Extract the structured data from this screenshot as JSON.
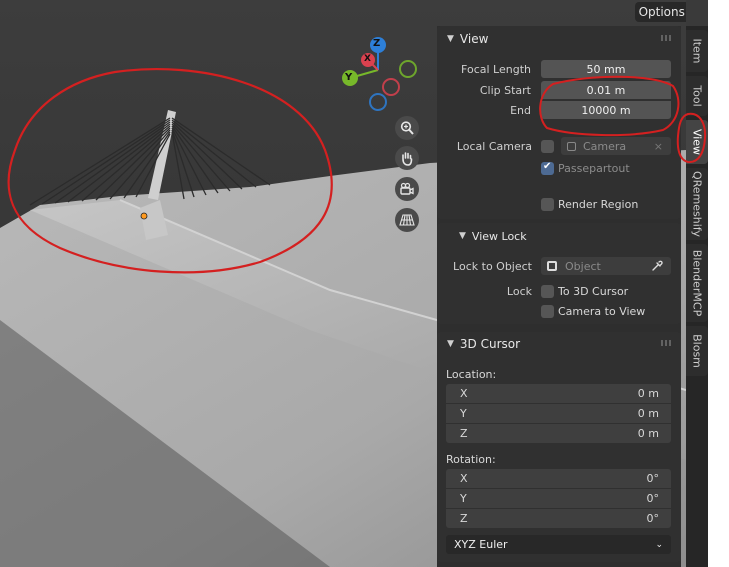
{
  "header": {
    "options_label": "Options"
  },
  "gizmo": {
    "z_label": "Z",
    "y_label": "Y",
    "x_label": "X"
  },
  "panels": {
    "view": {
      "title": "View",
      "focal_length_label": "Focal Length",
      "focal_length_value": "50 mm",
      "clip_start_label": "Clip Start",
      "clip_start_value": "0.01 m",
      "end_label": "End",
      "end_value": "10000 m",
      "local_camera_label": "Local Camera",
      "camera_placeholder": "Camera",
      "passepartout_label": "Passepartout",
      "render_region_label": "Render Region"
    },
    "view_lock": {
      "title": "View Lock",
      "lock_to_object_label": "Lock to Object",
      "object_placeholder": "Object",
      "lock_label": "Lock",
      "to_3d_cursor_label": "To 3D Cursor",
      "camera_to_view_label": "Camera to View"
    },
    "cursor": {
      "title": "3D Cursor",
      "location_label": "Location:",
      "location": [
        {
          "axis": "X",
          "value": "0 m"
        },
        {
          "axis": "Y",
          "value": "0 m"
        },
        {
          "axis": "Z",
          "value": "0 m"
        }
      ],
      "rotation_label": "Rotation:",
      "rotation": [
        {
          "axis": "X",
          "value": "0°"
        },
        {
          "axis": "Y",
          "value": "0°"
        },
        {
          "axis": "Z",
          "value": "0°"
        }
      ],
      "rotation_mode": "XYZ Euler"
    }
  },
  "tabs": [
    "Item",
    "Tool",
    "View",
    "QRemeshify",
    "BlenderMCP",
    "Blosm"
  ],
  "colors": {
    "annotation": "#d42020",
    "axis_x": "#d9414f",
    "axis_y": "#77b82a",
    "axis_z": "#2d7fd8"
  }
}
